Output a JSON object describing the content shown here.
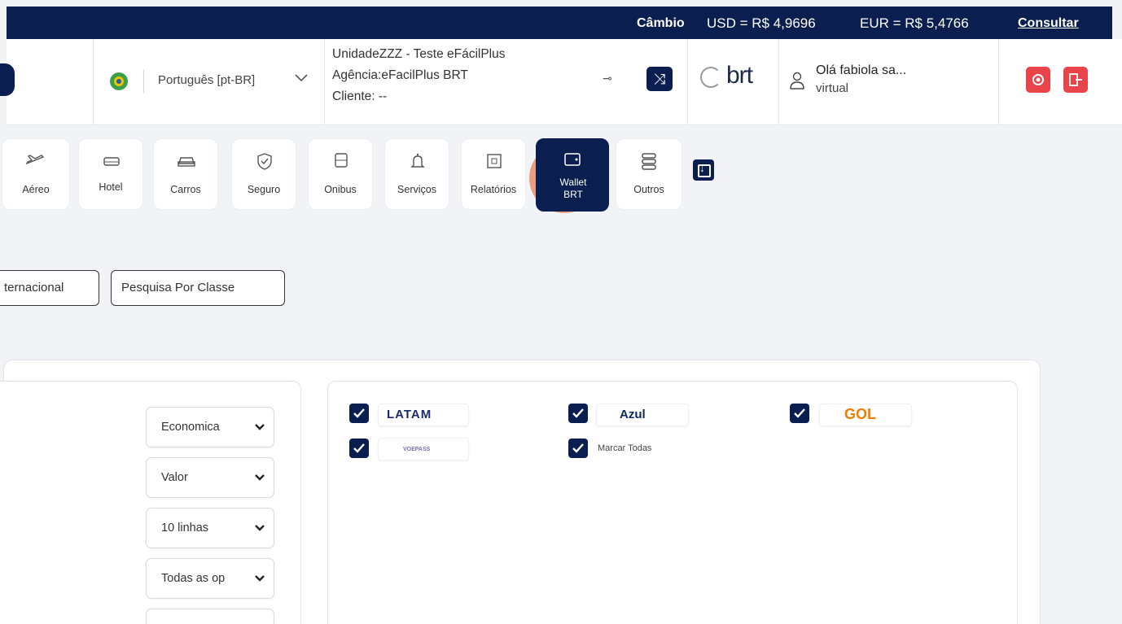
{
  "exchange": {
    "label": "Câmbio",
    "usd": "USD = R$ 4,9696",
    "eur": "EUR = R$ 5,4766",
    "consult_link": "Consultar"
  },
  "header": {
    "language": "Português [pt-BR]",
    "unit": "UnidadeZZZ - Teste eFácilPlus",
    "agency": "Agência:eFacilPlus BRT",
    "client": "Cliente: --",
    "brand": "brt",
    "user_greeting": "Olá fabiola sa...",
    "user_role": "virtual"
  },
  "modules": [
    {
      "label": "Aéreo",
      "icon": "plane-icon"
    },
    {
      "label": "Hotel",
      "icon": "bed-icon"
    },
    {
      "label": "Carros",
      "icon": "car-icon"
    },
    {
      "label": "Seguro",
      "icon": "shield-icon"
    },
    {
      "label": "Onibus",
      "icon": "bus-icon"
    },
    {
      "label": "Serviços",
      "icon": "bell-icon"
    },
    {
      "label": "Relatórios",
      "icon": "report-icon"
    },
    {
      "label": "Wallet BRT",
      "icon": "wallet-icon",
      "active": true
    },
    {
      "label": "Outros",
      "icon": "stack-icon"
    }
  ],
  "search_modes": {
    "international": "ternacional",
    "by_class": "Pesquisa Por Classe"
  },
  "filters": {
    "cabin": "Economica",
    "sort": "Valor",
    "rows": "10 linhas",
    "options": "Todas as op"
  },
  "airlines": {
    "latam": "LATAM",
    "azul": "Azul",
    "gol": "GOL",
    "voepass": "VOEPASS",
    "select_all": "Marcar Todas"
  },
  "colors": {
    "navy": "#0a1f4f",
    "danger": "#e8444a",
    "latam_pink": "#d4145a",
    "gol_orange": "#f07c00"
  }
}
